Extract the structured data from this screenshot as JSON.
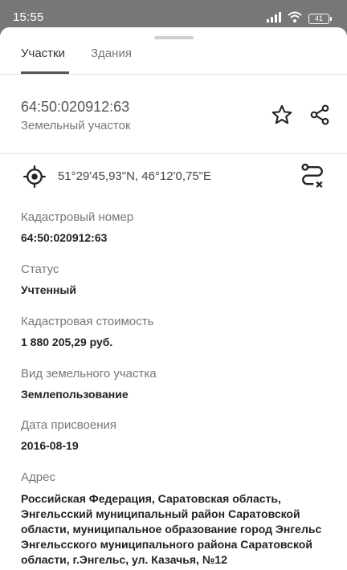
{
  "status_bar": {
    "time": "15:55",
    "battery": "41",
    "signal_icon": "signal-icon",
    "wifi_icon": "wifi-icon",
    "background": "#777777"
  },
  "tabs": [
    {
      "label": "Участки",
      "active": true
    },
    {
      "label": "Здания",
      "active": false
    }
  ],
  "parcel": {
    "id": "64:50:020912:63",
    "type": "Земельный участок",
    "star_icon": "star-icon",
    "share_icon": "share-icon"
  },
  "coordinates": {
    "text": "51°29'45,93\"N, 46°12'0,75\"E",
    "location_icon": "target-icon",
    "route_icon": "route-icon"
  },
  "fields": [
    {
      "label": "Кадастровый номер",
      "value": "64:50:020912:63"
    },
    {
      "label": "Статус",
      "value": "Учтенный"
    },
    {
      "label": "Кадастровая стоимость",
      "value": "1 880 205,29 руб."
    },
    {
      "label": "Вид земельного участка",
      "value": "Землепользование"
    },
    {
      "label": "Дата присвоения",
      "value": "2016-08-19"
    }
  ],
  "address": {
    "label": "Адрес",
    "lines": [
      "Российская Федерация, Саратовская область,",
      "Энгельсский муниципальный район Саратовской",
      "области, муниципальное образование город Энгельс",
      "Энгельсского муниципального района Саратовской",
      "области, г.Энгельс, ул. Казачья, №12"
    ]
  }
}
